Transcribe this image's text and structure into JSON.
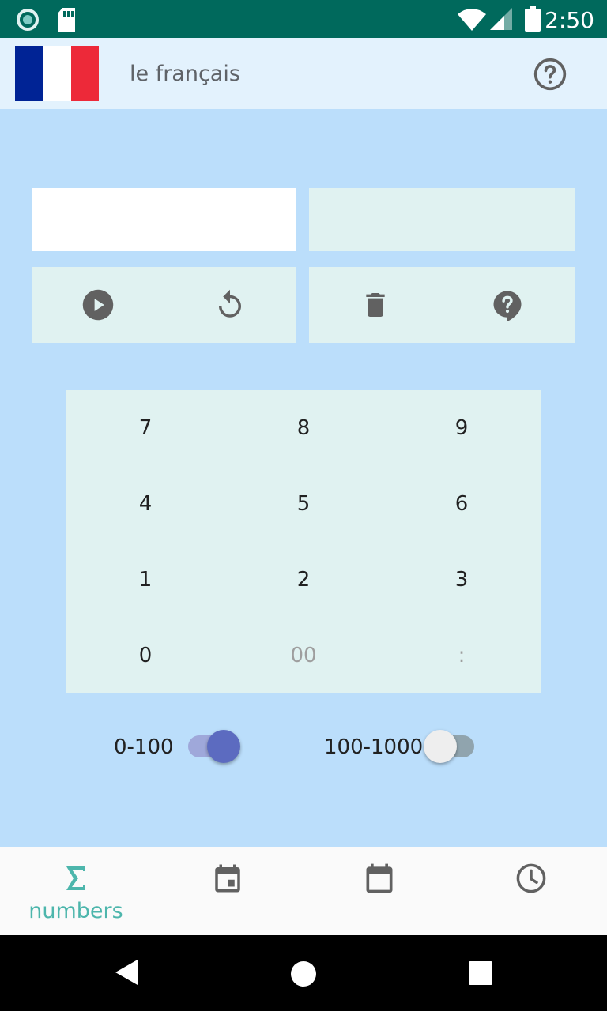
{
  "status_bar": {
    "time": "2:50"
  },
  "app_bar": {
    "language": "le français",
    "flag_colors": [
      "#002395",
      "#ffffff",
      "#ed2939"
    ],
    "help_icon": "help-circle-outline-icon"
  },
  "answer": {
    "input_value": "",
    "output_value": ""
  },
  "controls": {
    "left": [
      "play-icon",
      "replay-icon"
    ],
    "right": [
      "delete-icon",
      "help-bubble-icon"
    ]
  },
  "keypad": {
    "keys": [
      {
        "label": "7",
        "enabled": true
      },
      {
        "label": "8",
        "enabled": true
      },
      {
        "label": "9",
        "enabled": true
      },
      {
        "label": "4",
        "enabled": true
      },
      {
        "label": "5",
        "enabled": true
      },
      {
        "label": "6",
        "enabled": true
      },
      {
        "label": "1",
        "enabled": true
      },
      {
        "label": "2",
        "enabled": true
      },
      {
        "label": "3",
        "enabled": true
      },
      {
        "label": "0",
        "enabled": true
      },
      {
        "label": "00",
        "enabled": false
      },
      {
        "label": ":",
        "enabled": false
      }
    ]
  },
  "ranges": [
    {
      "label": "0-100",
      "on": true
    },
    {
      "label": "100-1000",
      "on": false
    }
  ],
  "bottom_nav": {
    "items": [
      {
        "icon": "sigma-icon",
        "label": "numbers",
        "active": true
      },
      {
        "icon": "calendar-today-icon",
        "label": "",
        "active": false
      },
      {
        "icon": "calendar-icon",
        "label": "",
        "active": false
      },
      {
        "icon": "clock-icon",
        "label": "",
        "active": false
      }
    ]
  },
  "colors": {
    "accent": "#4db6ac",
    "switch_on": "#5c6bc0",
    "background": "#bbdefb",
    "panel": "#e0f2f1"
  }
}
